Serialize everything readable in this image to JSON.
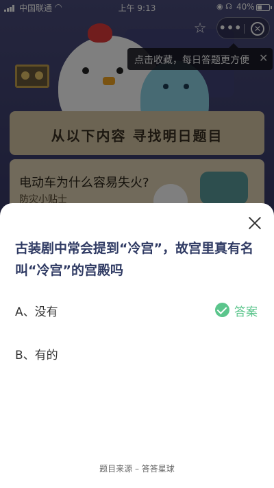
{
  "status_bar": {
    "carrier": "中国联通",
    "time": "上午 9:13",
    "battery_percent": "40%",
    "battery_level": 0.4
  },
  "background": {
    "banner_title": "从以下内容 寻找明日题目",
    "card_question": "电动车为什么容易失火?",
    "card_subtitle": "防灾小贴士"
  },
  "tooltip": {
    "text": "点击收藏，每日答题更方便"
  },
  "sheet": {
    "question": "古装剧中常会提到“冷宫”，故宫里真有名叫“冷宫”的宫殿吗",
    "options": [
      {
        "label": "A、没有",
        "is_answer": true
      },
      {
        "label": "B、有的",
        "is_answer": false
      }
    ],
    "answer_label": "答案",
    "source": "题目来源 – 答答星球"
  },
  "colors": {
    "accent_green": "#5bc58c",
    "question_text": "#2f3a63"
  },
  "icons": [
    "signal-icon",
    "wifi-icon",
    "star-icon",
    "more-icon",
    "close-circle-icon",
    "close-icon",
    "check-icon"
  ]
}
